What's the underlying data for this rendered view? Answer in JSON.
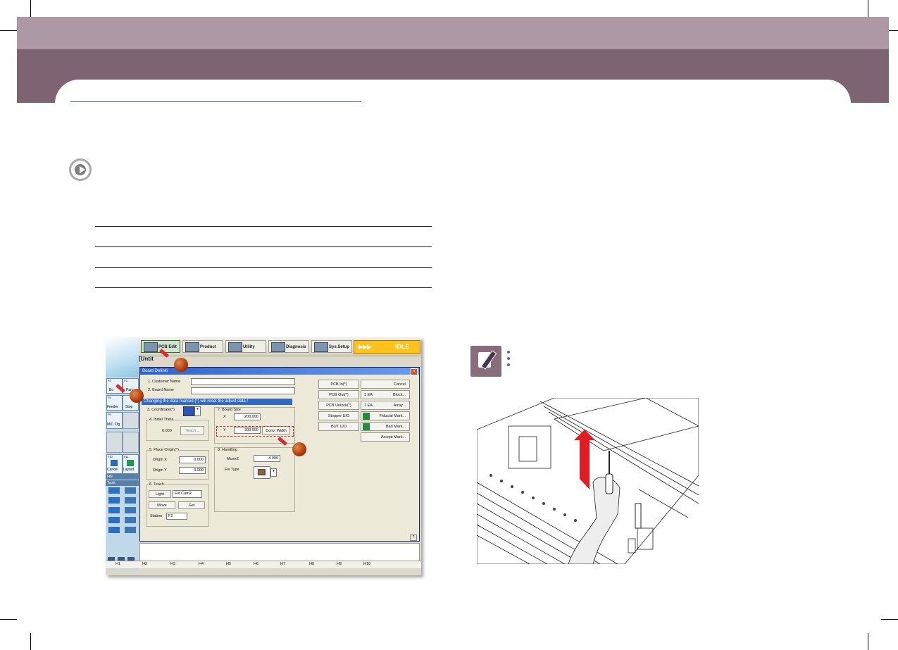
{
  "page": {
    "band_top_color": "#ad98a5",
    "band_bottom_color": "#7e6473",
    "rule_color": "#466a86"
  },
  "screenshot": {
    "toolbar": [
      {
        "label": "PCB Edit"
      },
      {
        "label": "Product"
      },
      {
        "label": "Utility"
      },
      {
        "label": "Diagnosis"
      },
      {
        "label": "Sys.Setup"
      }
    ],
    "status": {
      "arrows": "▶▶▶",
      "text": "IDLE"
    },
    "file_tab": "[Untit",
    "sidebar": {
      "buttons": [
        "Bo",
        "Part",
        "Feeder",
        "Stop",
        "M/C Cfg",
        "Cancel",
        "Layout"
      ],
      "f_labels": [
        "F2",
        "F3",
        "F5",
        "F9",
        "F6",
        "F10",
        "F11"
      ],
      "menus": [
        "File",
        "Tools"
      ]
    },
    "dialog": {
      "title": "Board Definiti",
      "close": "X",
      "customer_name_label": "1. Customer Name",
      "board_name_label": "2. Board Name",
      "warning": "Changing the data marked (*) will reset the adjust data !",
      "coordinate_label": "3. Coordinate(*)",
      "initial_theta_label": "4. Initial Theta",
      "initial_theta_value": "0.000",
      "teach_button": "Teach...",
      "place_origin_label": "5. Place Origin(*)",
      "origin_x_label": "Origin X",
      "origin_x_value": "0.000",
      "origin_y_label": "Origin Y",
      "origin_y_value": "0.000",
      "teach_group_label": "6. Teach",
      "light_label": "Light",
      "light_value": "Fid Cam2",
      "move_label": "Move",
      "get_label": "Get",
      "station_label": "Station",
      "station_value": "F2",
      "board_size_label": "7. Board Size",
      "x_label": "X",
      "x_value": "200.000",
      "y_label": "Y",
      "y_value": "200.000",
      "conv_width_button": "Conv. Width",
      "handling_label": "8. Handling",
      "movez_label": "MoveZ",
      "movez_value": "4.000",
      "fix_type_label": "Fix Type",
      "right_buttons": [
        "PCB In(*)",
        "PCB Out(*)",
        "PCB Unlock(*)",
        "Stopper U/D",
        "BUT U/D"
      ],
      "right_buttons_b": [
        "Cancel",
        "Block...",
        "Array...",
        "Fiducial Mark...",
        "Bad Mark...",
        "Accept Mark..."
      ],
      "ea_labels": [
        "1 EA",
        "1 EA"
      ],
      "help_mark": "?"
    },
    "hotkeys": [
      "H1",
      "H2",
      "H3",
      "H4",
      "H5",
      "H6",
      "H7",
      "H8",
      "H9",
      "H10"
    ]
  },
  "icons": {
    "play": "play-circle-icon",
    "note": "note-pencil-icon",
    "figure": "conveyor-pin-lift-illustration"
  }
}
